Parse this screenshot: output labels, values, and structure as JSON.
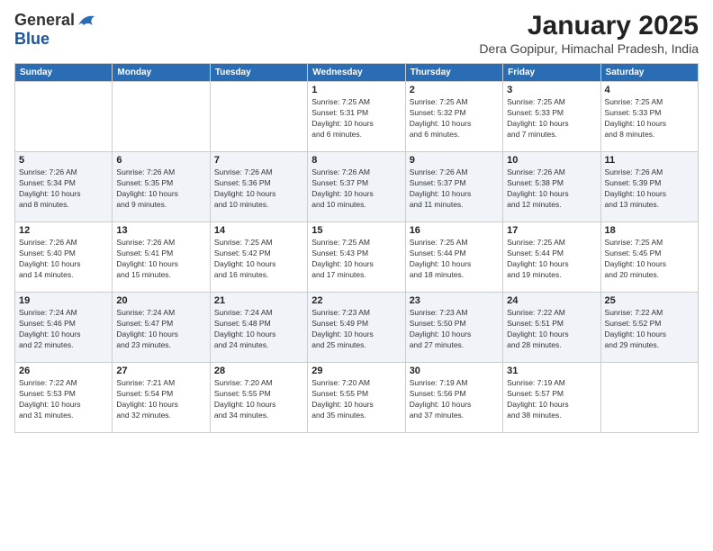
{
  "logo": {
    "general": "General",
    "blue": "Blue"
  },
  "title": "January 2025",
  "subtitle": "Dera Gopipur, Himachal Pradesh, India",
  "headers": [
    "Sunday",
    "Monday",
    "Tuesday",
    "Wednesday",
    "Thursday",
    "Friday",
    "Saturday"
  ],
  "weeks": [
    [
      {
        "day": "",
        "info": ""
      },
      {
        "day": "",
        "info": ""
      },
      {
        "day": "",
        "info": ""
      },
      {
        "day": "1",
        "info": "Sunrise: 7:25 AM\nSunset: 5:31 PM\nDaylight: 10 hours\nand 6 minutes."
      },
      {
        "day": "2",
        "info": "Sunrise: 7:25 AM\nSunset: 5:32 PM\nDaylight: 10 hours\nand 6 minutes."
      },
      {
        "day": "3",
        "info": "Sunrise: 7:25 AM\nSunset: 5:33 PM\nDaylight: 10 hours\nand 7 minutes."
      },
      {
        "day": "4",
        "info": "Sunrise: 7:25 AM\nSunset: 5:33 PM\nDaylight: 10 hours\nand 8 minutes."
      }
    ],
    [
      {
        "day": "5",
        "info": "Sunrise: 7:26 AM\nSunset: 5:34 PM\nDaylight: 10 hours\nand 8 minutes."
      },
      {
        "day": "6",
        "info": "Sunrise: 7:26 AM\nSunset: 5:35 PM\nDaylight: 10 hours\nand 9 minutes."
      },
      {
        "day": "7",
        "info": "Sunrise: 7:26 AM\nSunset: 5:36 PM\nDaylight: 10 hours\nand 10 minutes."
      },
      {
        "day": "8",
        "info": "Sunrise: 7:26 AM\nSunset: 5:37 PM\nDaylight: 10 hours\nand 10 minutes."
      },
      {
        "day": "9",
        "info": "Sunrise: 7:26 AM\nSunset: 5:37 PM\nDaylight: 10 hours\nand 11 minutes."
      },
      {
        "day": "10",
        "info": "Sunrise: 7:26 AM\nSunset: 5:38 PM\nDaylight: 10 hours\nand 12 minutes."
      },
      {
        "day": "11",
        "info": "Sunrise: 7:26 AM\nSunset: 5:39 PM\nDaylight: 10 hours\nand 13 minutes."
      }
    ],
    [
      {
        "day": "12",
        "info": "Sunrise: 7:26 AM\nSunset: 5:40 PM\nDaylight: 10 hours\nand 14 minutes."
      },
      {
        "day": "13",
        "info": "Sunrise: 7:26 AM\nSunset: 5:41 PM\nDaylight: 10 hours\nand 15 minutes."
      },
      {
        "day": "14",
        "info": "Sunrise: 7:25 AM\nSunset: 5:42 PM\nDaylight: 10 hours\nand 16 minutes."
      },
      {
        "day": "15",
        "info": "Sunrise: 7:25 AM\nSunset: 5:43 PM\nDaylight: 10 hours\nand 17 minutes."
      },
      {
        "day": "16",
        "info": "Sunrise: 7:25 AM\nSunset: 5:44 PM\nDaylight: 10 hours\nand 18 minutes."
      },
      {
        "day": "17",
        "info": "Sunrise: 7:25 AM\nSunset: 5:44 PM\nDaylight: 10 hours\nand 19 minutes."
      },
      {
        "day": "18",
        "info": "Sunrise: 7:25 AM\nSunset: 5:45 PM\nDaylight: 10 hours\nand 20 minutes."
      }
    ],
    [
      {
        "day": "19",
        "info": "Sunrise: 7:24 AM\nSunset: 5:46 PM\nDaylight: 10 hours\nand 22 minutes."
      },
      {
        "day": "20",
        "info": "Sunrise: 7:24 AM\nSunset: 5:47 PM\nDaylight: 10 hours\nand 23 minutes."
      },
      {
        "day": "21",
        "info": "Sunrise: 7:24 AM\nSunset: 5:48 PM\nDaylight: 10 hours\nand 24 minutes."
      },
      {
        "day": "22",
        "info": "Sunrise: 7:23 AM\nSunset: 5:49 PM\nDaylight: 10 hours\nand 25 minutes."
      },
      {
        "day": "23",
        "info": "Sunrise: 7:23 AM\nSunset: 5:50 PM\nDaylight: 10 hours\nand 27 minutes."
      },
      {
        "day": "24",
        "info": "Sunrise: 7:22 AM\nSunset: 5:51 PM\nDaylight: 10 hours\nand 28 minutes."
      },
      {
        "day": "25",
        "info": "Sunrise: 7:22 AM\nSunset: 5:52 PM\nDaylight: 10 hours\nand 29 minutes."
      }
    ],
    [
      {
        "day": "26",
        "info": "Sunrise: 7:22 AM\nSunset: 5:53 PM\nDaylight: 10 hours\nand 31 minutes."
      },
      {
        "day": "27",
        "info": "Sunrise: 7:21 AM\nSunset: 5:54 PM\nDaylight: 10 hours\nand 32 minutes."
      },
      {
        "day": "28",
        "info": "Sunrise: 7:20 AM\nSunset: 5:55 PM\nDaylight: 10 hours\nand 34 minutes."
      },
      {
        "day": "29",
        "info": "Sunrise: 7:20 AM\nSunset: 5:55 PM\nDaylight: 10 hours\nand 35 minutes."
      },
      {
        "day": "30",
        "info": "Sunrise: 7:19 AM\nSunset: 5:56 PM\nDaylight: 10 hours\nand 37 minutes."
      },
      {
        "day": "31",
        "info": "Sunrise: 7:19 AM\nSunset: 5:57 PM\nDaylight: 10 hours\nand 38 minutes."
      },
      {
        "day": "",
        "info": ""
      }
    ]
  ]
}
